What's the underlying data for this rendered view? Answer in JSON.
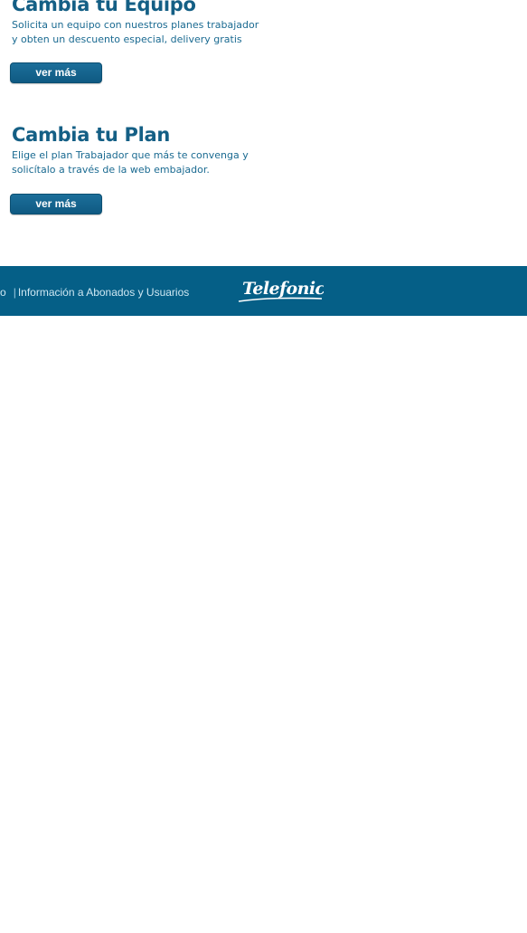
{
  "promos": [
    {
      "title": "Cambia tu Equipo",
      "description_lines": [
        "Solicita un equipo con nuestros planes trabajador",
        "y obten un descuento especial, delivery gratis"
      ],
      "button_label": "ver más"
    },
    {
      "title": "Cambia tu Plan",
      "description_lines": [
        "Elige el plan Trabajador que más te convenga y",
        "solicítalo a través de la web embajador."
      ],
      "button_label": "ver más"
    }
  ],
  "footer": {
    "partial_link": "o",
    "separator": "|",
    "info_link": "Información a Abonados y Usuarios",
    "logo_text": "Telefonica"
  },
  "colors": {
    "brand_blue": "#055f87",
    "title_blue": "#145f85",
    "button_blue": "#1c6f9a",
    "background": "#ffffff"
  }
}
